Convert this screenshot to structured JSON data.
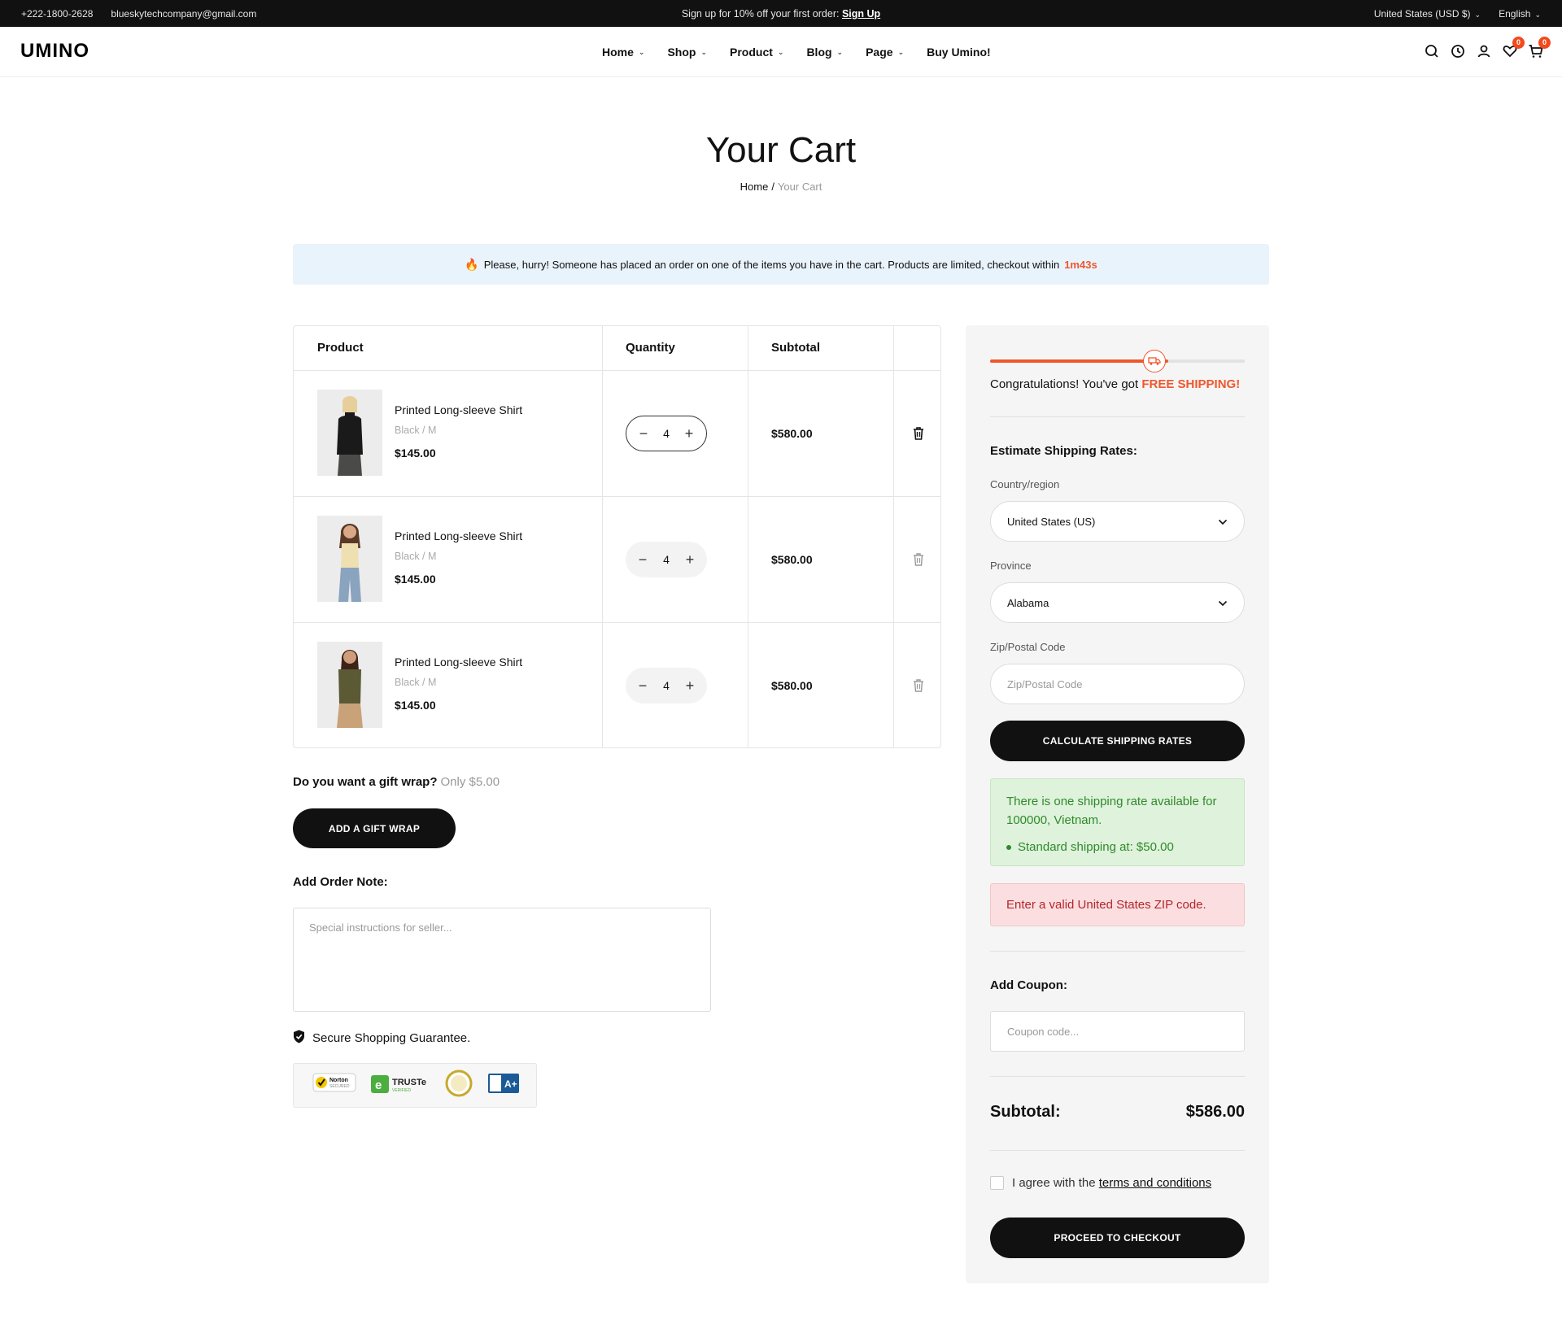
{
  "topbar": {
    "phone": "+222-1800-2628",
    "email": "blueskytechcompany@gmail.com",
    "promo_text": "Sign up for 10% off your first order: ",
    "promo_link": "Sign Up",
    "currency": "United States (USD $)",
    "language": "English"
  },
  "header": {
    "logo": "UMINO",
    "nav": [
      {
        "label": "Home",
        "has_dropdown": true
      },
      {
        "label": "Shop",
        "has_dropdown": true
      },
      {
        "label": "Product",
        "has_dropdown": true
      },
      {
        "label": "Blog",
        "has_dropdown": true
      },
      {
        "label": "Page",
        "has_dropdown": true
      },
      {
        "label": "Buy Umino!",
        "has_dropdown": false
      }
    ],
    "icons": [
      "search-icon",
      "history-icon",
      "user-icon",
      "wishlist-icon",
      "cart-icon"
    ],
    "wishlist_count": "0",
    "cart_count": "0"
  },
  "page": {
    "title": "Your Cart",
    "breadcrumb_home": "Home",
    "breadcrumb_sep": "/",
    "breadcrumb_current": "Your Cart"
  },
  "banner": {
    "text": "Please, hurry! Someone has placed an order on one of the items you have in the cart. Products are limited, checkout within",
    "timer": "1m43s"
  },
  "cart": {
    "headers": {
      "product": "Product",
      "quantity": "Quantity",
      "subtotal": "Subtotal"
    },
    "items": [
      {
        "name": "Printed Long-sleeve Shirt",
        "variant": "Black / M",
        "price": "$145.00",
        "qty": "4",
        "subtotal": "$580.00"
      },
      {
        "name": "Printed Long-sleeve Shirt",
        "variant": "Black / M",
        "price": "$145.00",
        "qty": "4",
        "subtotal": "$580.00"
      },
      {
        "name": "Printed Long-sleeve Shirt",
        "variant": "Black / M",
        "price": "$145.00",
        "qty": "4",
        "subtotal": "$580.00"
      }
    ]
  },
  "gift": {
    "question": "Do you want a gift wrap?",
    "price_text": "Only $5.00",
    "button": "ADD A GIFT WRAP"
  },
  "note": {
    "label": "Add Order Note:",
    "placeholder": "Special instructions for seller..."
  },
  "secure_text": "Secure Shopping Guarantee.",
  "trust_badges": [
    "Norton",
    "TRUSTe",
    "BBB A+"
  ],
  "sidebar": {
    "shipping_progress": 0.7,
    "congrats_text": "Congratulations! You've got ",
    "congrats_highlight": "FREE SHIPPING!",
    "estimate_heading": "Estimate Shipping Rates:",
    "country_label": "Country/region",
    "country_value": "United States (US)",
    "province_label": "Province",
    "province_value": "Alabama",
    "zip_label": "Zip/Postal Code",
    "zip_placeholder": "Zip/Postal Code",
    "calc_button": "CALCULATE SHIPPING RATES",
    "rate_text": "There is one shipping rate available for 100000, Vietnam.",
    "rate_item": "Standard shipping at: $50.00",
    "error_text": "Enter a valid United States ZIP code.",
    "coupon_heading": "Add Coupon:",
    "coupon_placeholder": "Coupon code...",
    "subtotal_label": "Subtotal:",
    "subtotal_value": "$586.00",
    "agree_text": "I agree with the ",
    "agree_link": "terms and conditions",
    "checkout_button": "PROCEED TO CHECKOUT"
  },
  "colors": {
    "accent": "#f0572d",
    "dark": "#111111",
    "banner_bg": "#e9f3fc",
    "success_bg": "#dff2dc",
    "error_bg": "#fbdfe0"
  }
}
